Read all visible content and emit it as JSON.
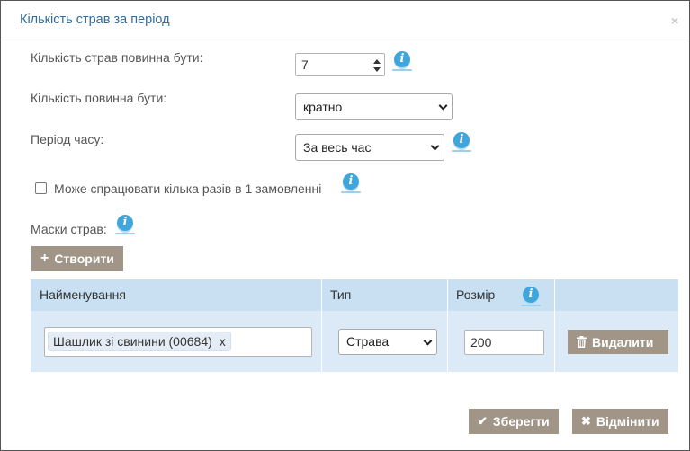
{
  "dialog": {
    "title": "Кількість страв за період",
    "close": "×"
  },
  "form": {
    "dish_count_label": "Кількість страв повинна бути:",
    "dish_count_value": "7",
    "multiplicity_label": "Кількість повинна бути:",
    "multiplicity_value": "кратно",
    "period_label": "Період часу:",
    "period_value": "За весь час",
    "multi_trigger_label": "Може спрацювати кілька разів в 1 замовленні",
    "masks_label": "Маски страв:",
    "create_button": "Створити"
  },
  "table": {
    "headers": [
      "Найменування",
      "Тип",
      "Розмір",
      ""
    ],
    "rows": [
      {
        "tag": "Шашлик зі свинини (00684)",
        "tag_remove": "x",
        "type": "Страва",
        "size": "200",
        "delete_button": "Видалити"
      }
    ]
  },
  "footer": {
    "save_button": "Зберегти",
    "cancel_button": "Відмінити"
  },
  "icons": {
    "info": "i",
    "plus": "+",
    "check": "✔",
    "times": "✖"
  },
  "colors": {
    "accent": "#2f6c9f",
    "info": "#3ea6dd",
    "button": "#a09587",
    "table_header": "#c9e0f3",
    "table_row": "#dceaf7"
  }
}
